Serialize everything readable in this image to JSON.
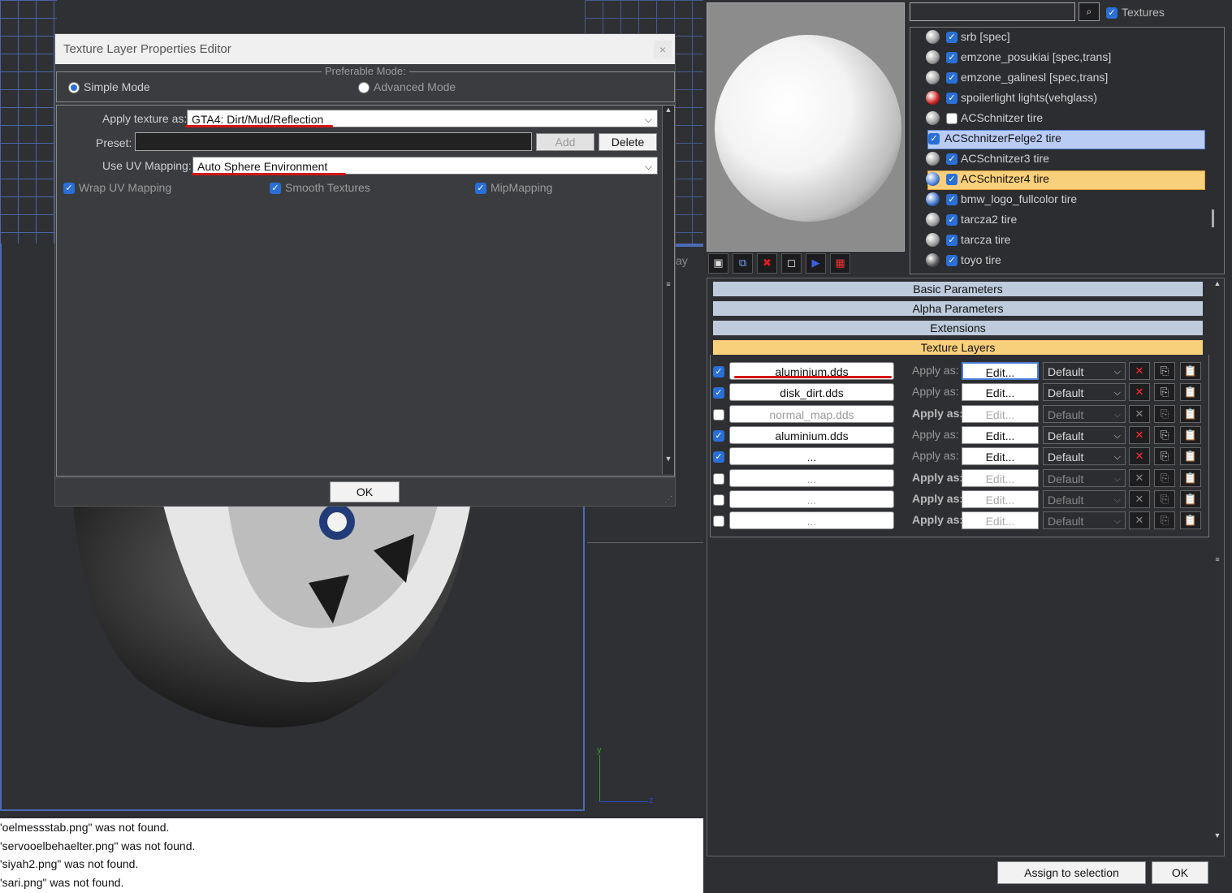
{
  "dialog": {
    "title": "Texture Layer Properties Editor",
    "close": "×",
    "group_title": "Preferable Mode:",
    "simple_mode": "Simple Mode",
    "advanced_mode": "Advanced Mode",
    "apply_label": "Apply texture as:",
    "apply_value": "GTA4: Dirt/Mud/Reflection",
    "preset_label": "Preset:",
    "add": "Add",
    "delete": "Delete",
    "uv_label": "Use UV Mapping:",
    "uv_value": "Auto Sphere Environment",
    "wrap": "Wrap UV Mapping",
    "smooth": "Smooth Textures",
    "mip": "MipMapping",
    "ok": "OK"
  },
  "viewport": {
    "side_text": "ay",
    "axis_y": "y",
    "axis_z": "z"
  },
  "log": [
    "'oelmessstab.png\" was not found.",
    "'servooelbehaelter.png\" was not found.",
    "'siyah2.png\" was not found.",
    "'sari.png\" was not found."
  ],
  "panel": {
    "textures_label": "Textures",
    "materials": [
      {
        "name": "srb [spec]",
        "checked": true
      },
      {
        "name": "emzone_posukiai [spec,trans]",
        "checked": true
      },
      {
        "name": "emzone_galinesl [spec,trans]",
        "checked": true
      },
      {
        "name": "spoilerlight lights(vehglass)",
        "checked": true
      },
      {
        "name": "ACSchnitzer tire",
        "checked": false
      },
      {
        "name": "ACSchnitzerFelge2 tire",
        "checked": true
      },
      {
        "name": "ACSchnitzer3 tire",
        "checked": true
      },
      {
        "name": "ACSchnitzer4 tire",
        "checked": true
      },
      {
        "name": "bmw_logo_fullcolor tire",
        "checked": true
      },
      {
        "name": "tarcza2 tire",
        "checked": true
      },
      {
        "name": "tarcza tire",
        "checked": true
      },
      {
        "name": "toyo tire",
        "checked": true
      }
    ],
    "rollouts": [
      "Basic Parameters",
      "Alpha Parameters",
      "Extensions",
      "Texture Layers"
    ],
    "apply_as": "Apply as:",
    "edit": "Edit...",
    "layers": [
      {
        "file": "aluminium.dds",
        "enabled": true,
        "mode": "Default"
      },
      {
        "file": "disk_dirt.dds",
        "enabled": true,
        "mode": "Default"
      },
      {
        "file": "normal_map.dds",
        "enabled": false,
        "mode": "Default"
      },
      {
        "file": "aluminium.dds",
        "enabled": true,
        "mode": "Default"
      },
      {
        "file": "...",
        "enabled": true,
        "mode": "Default"
      },
      {
        "file": "...",
        "enabled": false,
        "mode": "Default"
      },
      {
        "file": "...",
        "enabled": false,
        "mode": "Default"
      },
      {
        "file": "...",
        "enabled": false,
        "mode": "Default"
      }
    ],
    "assign": "Assign to selection",
    "ok": "OK"
  }
}
